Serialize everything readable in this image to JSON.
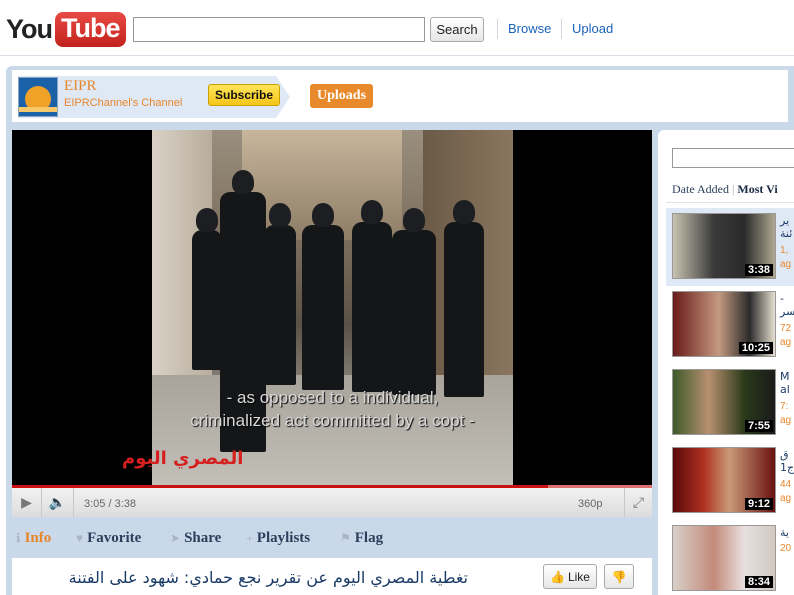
{
  "header": {
    "logo_you": "You",
    "logo_tube": "Tube",
    "search_placeholder": "",
    "search_button": "Search",
    "browse": "Browse",
    "upload": "Upload"
  },
  "channel": {
    "name": "EIPR",
    "subtitle": "EIPRChannel's Channel",
    "subscribe": "Subscribe",
    "uploads": "Uploads"
  },
  "player": {
    "subtitle_line1": "- as opposed to a individual,",
    "subtitle_line2": "criminalized act committed by a copt -",
    "watermark": "المصري اليوم",
    "time": "3:05 / 3:38",
    "quality": "360p",
    "progress": 0.84
  },
  "tabs": [
    {
      "label": "Info",
      "icon": "info-icon"
    },
    {
      "label": "Favorite",
      "icon": "heart-icon"
    },
    {
      "label": "Share",
      "icon": "share-icon"
    },
    {
      "label": "Playlists",
      "icon": "plus-icon"
    },
    {
      "label": "Flag",
      "icon": "flag-icon"
    }
  ],
  "video": {
    "title": "تغطية المصري اليوم عن تقرير نجع حمادي: شهود على الفتنة",
    "like": "Like"
  },
  "sidebar": {
    "sort_date": "Date Added",
    "sort_separator": "|",
    "sort_views": "Most Vi",
    "videos": [
      {
        "duration": "3:38",
        "title_l1": "ير",
        "title_l2": "ئنة",
        "meta_l1": "1,",
        "meta_l2": "ag"
      },
      {
        "duration": "10:25",
        "title_l1": "-",
        "title_l2": "سر",
        "meta_l1": "72",
        "meta_l2": "ag"
      },
      {
        "duration": "7:55",
        "title_l1": "M",
        "title_l2": "al",
        "meta_l1": "7:",
        "meta_l2": "ag"
      },
      {
        "duration": "9:12",
        "title_l1": "ق",
        "title_l2": "1ج",
        "meta_l1": "44",
        "meta_l2": "ag"
      },
      {
        "duration": "8:34",
        "title_l1": "ية",
        "title_l2": "",
        "meta_l1": "20",
        "meta_l2": ""
      }
    ]
  }
}
